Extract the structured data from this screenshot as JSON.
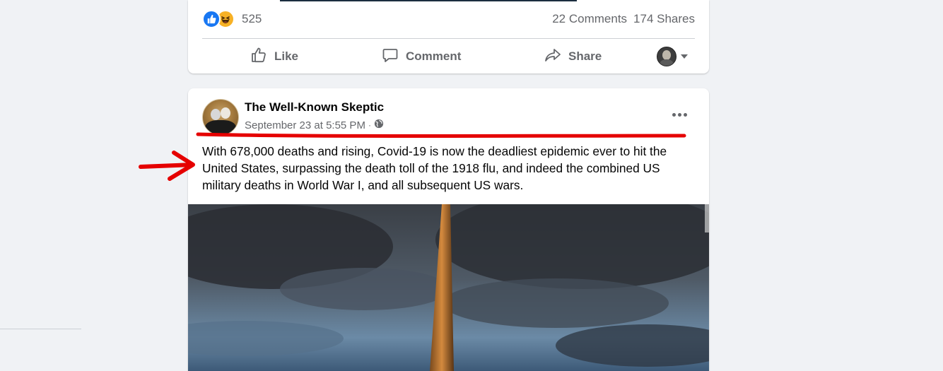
{
  "top_post": {
    "reaction_count": "525",
    "comments": "22 Comments",
    "shares": "174 Shares",
    "actions": {
      "like": "Like",
      "comment": "Comment",
      "share": "Share"
    },
    "reaction_icons": [
      "like-icon",
      "haha-icon"
    ]
  },
  "post": {
    "author": "The Well-Known Skeptic",
    "timestamp": "September 23 at 5:55 PM",
    "separator": "·",
    "privacy_icon": "globe-icon",
    "text": "With 678,000 deaths and rising, Covid-19 is now the deadliest epidemic ever to hit the United States, surpassing the death toll of the 1918 flu, and indeed the combined US military deaths in World War I, and all subsequent US wars.",
    "image_description_icon": "washington-monument-photo"
  },
  "colors": {
    "page_bg": "#f0f2f5",
    "card_bg": "#ffffff",
    "secondary_text": "#65676b",
    "like_blue": "#1877f2",
    "annotation_red": "#e50000"
  }
}
